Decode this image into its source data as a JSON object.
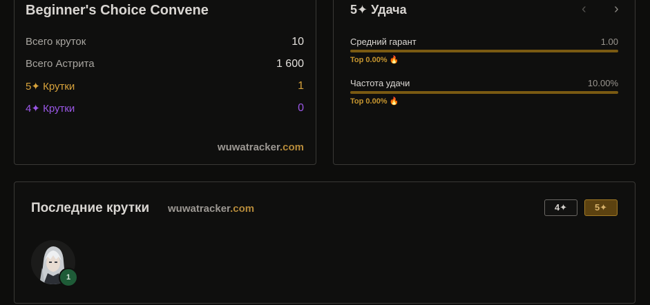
{
  "summary": {
    "title": "Beginner's Choice Convene",
    "rows": [
      {
        "label": "Всего круток",
        "value": "10"
      },
      {
        "label": "Всего Астрита",
        "value": "1 600"
      },
      {
        "label": "5✦ Крутки",
        "value": "1"
      },
      {
        "label": "4✦ Крутки",
        "value": "0"
      }
    ],
    "brand": {
      "part1": "wuwatracker",
      "part2": ".com"
    }
  },
  "luck": {
    "title": "5✦ Удача",
    "prev_icon": "‹",
    "next_icon": "›",
    "stats": [
      {
        "label": "Средний гарант",
        "value": "1.00",
        "top_text": "Top 0.00%",
        "fill_percent": 100
      },
      {
        "label": "Частота удачи",
        "value": "10.00%",
        "top_text": "Top 0.00%",
        "fill_percent": 100
      }
    ],
    "flame_icon": "🔥"
  },
  "recent": {
    "title": "Последние крутки",
    "brand": {
      "part1": "wuwatracker",
      "part2": ".com"
    },
    "filters": {
      "four_star": "4✦",
      "five_star": "5✦"
    },
    "pulls": [
      {
        "icon": "character-portrait-icon",
        "count": "1"
      }
    ]
  },
  "colors": {
    "gold": "#d7a23b",
    "purple": "#9a57e6",
    "badge_green": "#1e5b37",
    "bar_fill": "#7a5a12"
  }
}
